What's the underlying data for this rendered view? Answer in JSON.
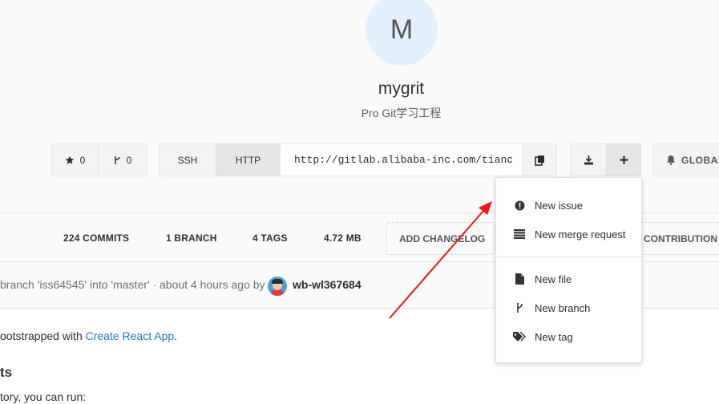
{
  "project": {
    "avatar_letter": "M",
    "name": "mygrit",
    "description": "Pro Git学习工程"
  },
  "actions": {
    "star_count": "0",
    "fork_count": "0",
    "ssh_label": "SSH",
    "http_label": "HTTP",
    "clone_url": "http://gitlab.alibaba-inc.com/tianc",
    "global_label": "GLOBAL"
  },
  "stats": {
    "commits": "224 COMMITS",
    "branch": "1 BRANCH",
    "tags": "4 TAGS",
    "size": "4.72 MB",
    "add_changelog": "ADD CHANGELOG",
    "contribution": "CONTRIBUTION GUIDE"
  },
  "last_commit": {
    "message": "branch 'iss64545' into 'master' · about 4 hours ago by",
    "author": "wb-wl367684"
  },
  "readme": {
    "line1_prefix": "ootstrapped with ",
    "line1_link": "Create React App",
    "line1_suffix": ".",
    "heading": "ts",
    "line2": "tory, you can run:"
  },
  "new_menu": {
    "items": [
      {
        "label": "New issue",
        "icon": "exclamation-circle-icon"
      },
      {
        "label": "New merge request",
        "icon": "merge-request-icon"
      },
      {
        "label": "New file",
        "icon": "file-icon"
      },
      {
        "label": "New branch",
        "icon": "branch-icon"
      },
      {
        "label": "New tag",
        "icon": "tag-icon"
      }
    ]
  },
  "annotation": {
    "arrow_color": "#e81818"
  }
}
